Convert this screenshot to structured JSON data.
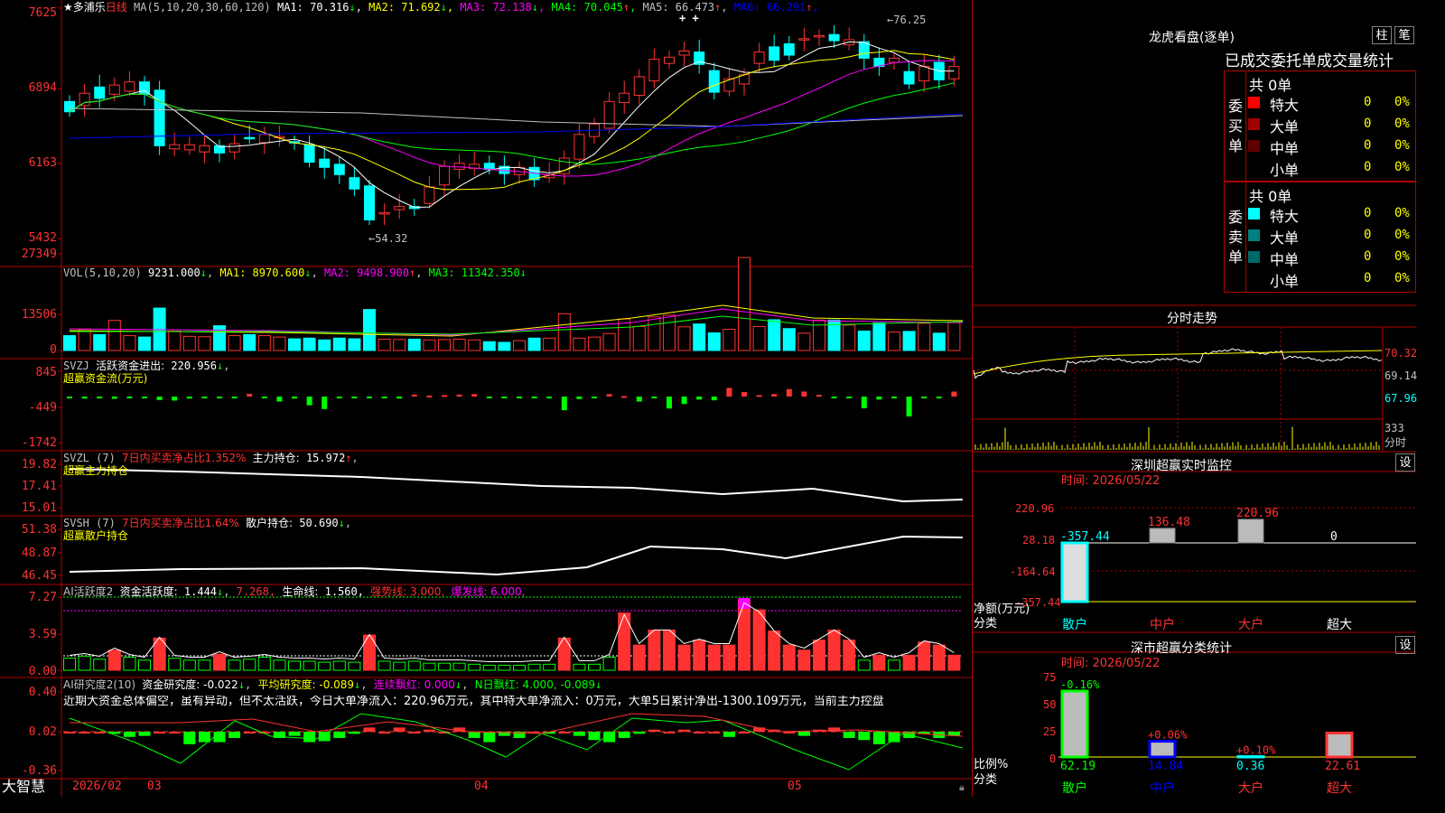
{
  "colors": {
    "up": "#ff3232",
    "down": "#00ffff",
    "grid": "#b00000",
    "ma1": "#ffffff",
    "ma2": "#ffff00",
    "ma3": "#ff00ff",
    "ma4": "#00ff00",
    "ma5": "#c0c0c0",
    "ma6": "#0000ff"
  },
  "price_panel": {
    "title_star": "★多浦乐",
    "period": "日线",
    "ma_params": "MA(5,10,20,30,60,120)",
    "ma_items": [
      {
        "label": "MA1:",
        "value": "70.316",
        "arrow": "↓",
        "color": "#ffffff"
      },
      {
        "label": "MA2:",
        "value": "71.692",
        "arrow": "↓",
        "color": "#ffff00"
      },
      {
        "label": "MA3:",
        "value": "72.138",
        "arrow": "↓",
        "color": "#ff00ff"
      },
      {
        "label": "MA4:",
        "value": "70.045",
        "arrow": "↑",
        "color": "#00ff00"
      },
      {
        "label": "MA5:",
        "value": "66.473",
        "arrow": "↑",
        "color": "#c0c0c0"
      },
      {
        "label": "MA6:",
        "value": "66.291",
        "arrow": "↑",
        "color": "#0000ff"
      }
    ],
    "y_ticks": [
      "7625",
      "6894",
      "6163",
      "5432"
    ],
    "high_note": "76.25",
    "low_note": "54.32",
    "plus_marks": "+ +"
  },
  "vol_panel": {
    "params": "VOL(5,10,20)",
    "value": "9231.000",
    "arrow": "↓",
    "ma1": "MA1: 8970.600",
    "ma1_arrow": "↓",
    "ma2": "MA2: 9498.900",
    "ma2_arrow": "↑",
    "ma3": "MA3: 11342.350",
    "ma3_arrow": "↓",
    "y_ticks": [
      "27349",
      "13506",
      "0"
    ]
  },
  "svzj_panel": {
    "name": "SVZJ",
    "desc": "活跃资金进出:",
    "value": "220.956",
    "arrow": "↓",
    "sub": "超赢资金流(万元)",
    "y_ticks": [
      "845",
      "-449",
      "-1742"
    ]
  },
  "svzl_panel": {
    "name": "SVZL (7)",
    "desc": "7日内买卖净占比1.352%",
    "hold": "主力持仓:",
    "value": "15.972",
    "arrow": "↑",
    "sub": "超赢主力持仓",
    "y_ticks": [
      "19.82",
      "17.41",
      "15.01"
    ]
  },
  "svsh_panel": {
    "name": "SVSH (7)",
    "desc": "7日内买卖净占比1.64%",
    "hold": "散户持仓:",
    "value": "50.690",
    "arrow": "↓",
    "sub": "超赢散户持仓",
    "y_ticks": [
      "51.38",
      "48.87",
      "46.45"
    ]
  },
  "ai_active_panel": {
    "name": "AI活跃度2",
    "v1_label": "资金活跃度:",
    "v1": "1.444",
    "v2": "7.268,",
    "v3_label": "生命线:",
    "v3": "1.560,",
    "v4": "强势线: 3.000,",
    "v5": "爆发线: 6.000,",
    "y_ticks": [
      "7.27",
      "3.59",
      "0.00"
    ]
  },
  "ai_research_panel": {
    "name": "AI研究度2(10)",
    "v1": "资金研究度: -0.022",
    "v2": "平均研究度: -0.089",
    "v3": "连续飘红: 0.000",
    "v4": "N日飘红: 4.000, -0.089",
    "comment": "近期大资金总体偏空，虽有异动，但不太活跃，今日大单净流入：220.96万元，其中特大单净流入：0万元，大单5日累计净出-1300.109万元，当前主力控盘",
    "y_ticks": [
      "0.40",
      "0.02",
      "-0.36"
    ]
  },
  "date_axis": {
    "brand": "大智慧",
    "labels": [
      "2026/02",
      "03",
      "04",
      "05"
    ]
  },
  "lhb": {
    "title": "龙虎看盘(逐单)",
    "btn1": "柱",
    "btn2": "笔",
    "tabs": [
      "已成交",
      "委托单",
      "成交量",
      "统计"
    ],
    "buy": {
      "side_label": "委买单",
      "count": "共 0单",
      "rows": [
        {
          "name": "特大",
          "value": "0",
          "pct": "0%",
          "color": "#ff0000"
        },
        {
          "name": "大单",
          "value": "0",
          "pct": "0%",
          "color": "#a00000"
        },
        {
          "name": "中单",
          "value": "0",
          "pct": "0%",
          "color": "#600000"
        },
        {
          "name": "小单",
          "value": "0",
          "pct": "0%",
          "color": ""
        }
      ]
    },
    "sell": {
      "side_label": "委卖单",
      "count": "共 0单",
      "rows": [
        {
          "name": "特大",
          "value": "0",
          "pct": "0%",
          "color": "#00ffff"
        },
        {
          "name": "大单",
          "value": "0",
          "pct": "0%",
          "color": "#008080"
        },
        {
          "name": "中单",
          "value": "0",
          "pct": "0%",
          "color": "#006868"
        },
        {
          "name": "小单",
          "value": "0",
          "pct": "0%",
          "color": ""
        }
      ]
    }
  },
  "fenshi": {
    "title": "分时走势",
    "y_ticks": [
      "70.32",
      "69.14",
      "67.96"
    ],
    "vol_ticks": [
      "333",
      "分时"
    ]
  },
  "sz_monitor": {
    "title": "深圳超赢实时监控",
    "set": "设",
    "time": "时间: 2026/05/22",
    "y_ticks": [
      "220.96",
      "28.18",
      "-164.64",
      "-357.44"
    ],
    "y_unit": "净额(万元)",
    "y_unit2": "分类",
    "bars": [
      {
        "name": "散户",
        "value": -357.44,
        "label": "-357.44"
      },
      {
        "name": "中户",
        "value": 136.48,
        "label": "136.48"
      },
      {
        "name": "大户",
        "value": 220.96,
        "label": "220.96"
      },
      {
        "name": "超大",
        "value": 0,
        "label": "0"
      }
    ]
  },
  "sz_class": {
    "title": "深市超赢分类统计",
    "set": "设",
    "time": "时间: 2026/05/22",
    "y_ticks": [
      "75",
      "50",
      "25",
      "0"
    ],
    "y_unit": "比例%",
    "y_unit2": "分类",
    "bars": [
      {
        "name": "散户",
        "value": 62.19,
        "label": "62.19",
        "delta": "-0.16%"
      },
      {
        "name": "中户",
        "value": 14.84,
        "label": "14.84",
        "delta": "+0.06%"
      },
      {
        "name": "大户",
        "value": 0.36,
        "label": "0.36",
        "delta": "+0.10%"
      },
      {
        "name": "超大",
        "value": 22.61,
        "label": "22.61",
        "delta": ""
      }
    ]
  }
}
